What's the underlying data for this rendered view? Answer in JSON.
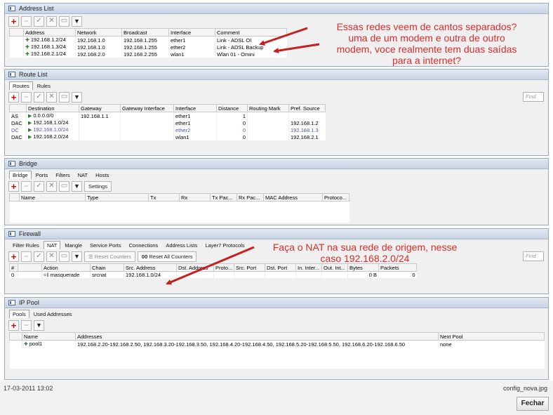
{
  "address_list": {
    "title": "Address List",
    "columns": [
      "Address",
      "Network",
      "Broadcast",
      "Interface",
      "Comment"
    ],
    "rows": [
      {
        "address": "192.168.1.2/24",
        "network": "192.168.1.0",
        "broadcast": "192.168.1.255",
        "interface": "ether1",
        "comment": "Link - ADSL OI"
      },
      {
        "address": "192.168.1.3/24",
        "network": "192.168.1.0",
        "broadcast": "192.168.1.255",
        "interface": "ether2",
        "comment": "Link - ADSL Backup"
      },
      {
        "address": "192.168.2.1/24",
        "network": "192.168.2.0",
        "broadcast": "192.168.2.255",
        "interface": "wlan1",
        "comment": "Wlan 01 - Omini"
      }
    ]
  },
  "route_list": {
    "title": "Route List",
    "tabs": [
      "Routes",
      "Rules"
    ],
    "find_placeholder": "Find",
    "columns": [
      "Destination",
      "Gateway",
      "Gateway Interface",
      "Interface",
      "Distance",
      "Routing Mark",
      "Pref. Source"
    ],
    "rows": [
      {
        "flags": "AS",
        "destination": "0.0.0.0/0",
        "gateway": "192.168.1.1",
        "gw_interface": "",
        "interface": "ether1",
        "distance": "1",
        "routing_mark": "",
        "pref_source": ""
      },
      {
        "flags": "DAC",
        "destination": "192.168.1.0/24",
        "gateway": "",
        "gw_interface": "",
        "interface": "ether1",
        "distance": "0",
        "routing_mark": "",
        "pref_source": "192.168.1.2"
      },
      {
        "flags": "DC",
        "destination": "192.168.1.0/24",
        "gateway": "",
        "gw_interface": "",
        "interface": "ether2",
        "distance": "0",
        "routing_mark": "",
        "pref_source": "192.168.1.3"
      },
      {
        "flags": "DAC",
        "destination": "192.168.2.0/24",
        "gateway": "",
        "gw_interface": "",
        "interface": "wlan1",
        "distance": "0",
        "routing_mark": "",
        "pref_source": "192.168.2.1"
      }
    ]
  },
  "bridge": {
    "title": "Bridge",
    "tabs": [
      "Bridge",
      "Ports",
      "Filters",
      "NAT",
      "Hosts"
    ],
    "settings_label": "Settings",
    "columns": [
      "Name",
      "Type",
      "Tx",
      "Rx",
      "Tx Pac...",
      "Rx Pac...",
      "MAC Address",
      "Protoco..."
    ]
  },
  "firewall": {
    "title": "Firewall",
    "tabs": [
      "Filter Rules",
      "NAT",
      "Mangle",
      "Service Ports",
      "Connections",
      "Address Lists",
      "Layer7 Protocols"
    ],
    "reset_counters": "Reset Counters",
    "reset_all_counters_icon": "00",
    "reset_all_counters": "Reset All Counters",
    "find_placeholder": "Find",
    "columns": [
      "#",
      "Action",
      "Chain",
      "Src. Address",
      "Dst. Address",
      "Proto...",
      "Src. Port",
      "Dst. Port",
      "In. Inter...",
      "Out. Int...",
      "Bytes",
      "Packets"
    ],
    "rows": [
      {
        "num": "0",
        "action": "masquerade",
        "chain": "srcnat",
        "src_address": "192.168.1.0/24",
        "bytes": "0 B",
        "packets": "0"
      }
    ]
  },
  "ip_pool": {
    "title": "IP Pool",
    "tabs": [
      "Pools",
      "Used Addresses"
    ],
    "columns": [
      "Name",
      "Addresses",
      "Next Pool"
    ],
    "rows": [
      {
        "name": "pool1",
        "addresses": "192.168.2.20-192.168.2.50, 192.168.3.20-192.168.3.50, 192.168.4.20-192.168.4.50, 192.168.5.20-192.168.5.50, 192.168.6.20-192.168.6.50",
        "next_pool": "none"
      }
    ]
  },
  "annotations": {
    "top": [
      "Essas redes veem de cantos separados?",
      "uma de um modem e outra de outro",
      "modem, voce realmente tem duas saídas",
      "para a internet?"
    ],
    "nat": [
      "Faça o NAT na sua rede de origem, nesse",
      "caso 192.168.2.0/24"
    ],
    "color": "#e12a2a"
  },
  "footer": {
    "timestamp": "17-03-2011 13:02",
    "filename": "config_nova.jpg",
    "close_label": "Fechar"
  }
}
